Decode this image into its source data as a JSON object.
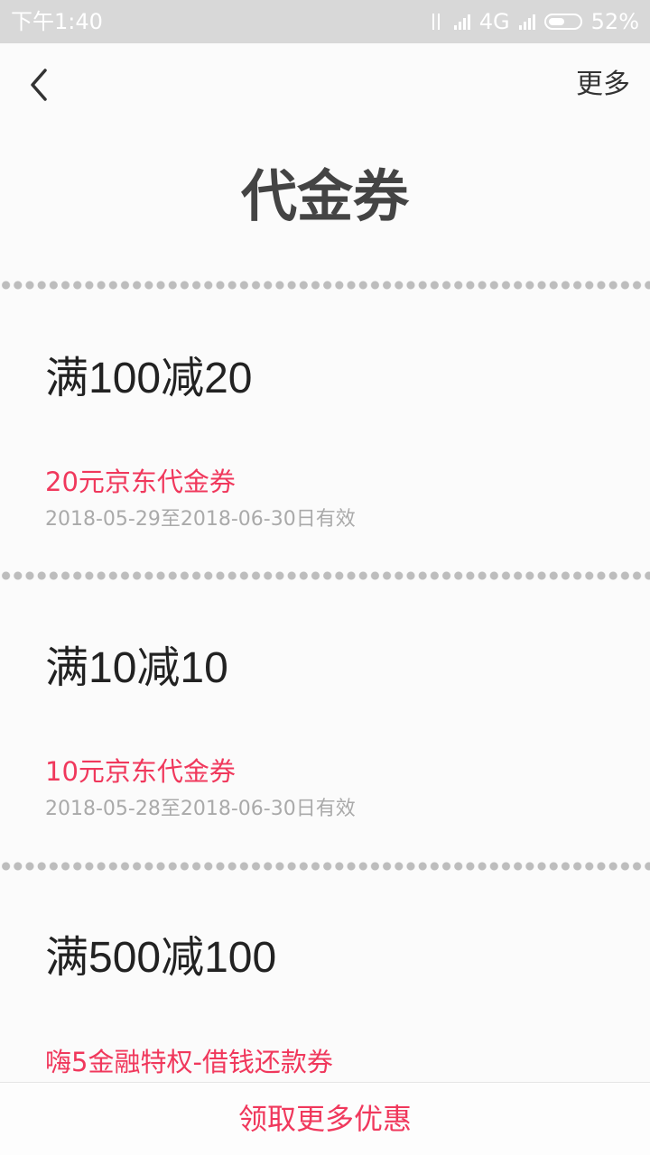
{
  "status_bar": {
    "time": "下午1:40",
    "network": "4G",
    "battery": "52%"
  },
  "header": {
    "back_icon": "chevron-left-icon",
    "more_label": "更多",
    "title": "代金券"
  },
  "coupons": [
    {
      "title": "满100减20",
      "name": "20元京东代金券",
      "validity": "2018-05-29至2018-06-30日有效"
    },
    {
      "title": "满10减10",
      "name": "10元京东代金券",
      "validity": "2018-05-28至2018-06-30日有效"
    },
    {
      "title": "满500减100",
      "name": "嗨5金融特权-借钱还款券"
    }
  ],
  "footer": {
    "label": "领取更多优惠"
  },
  "colors": {
    "accent": "#f0385c",
    "status_bar_bg": "#d8d8d8",
    "divider_dots": "#bdbdbd"
  }
}
